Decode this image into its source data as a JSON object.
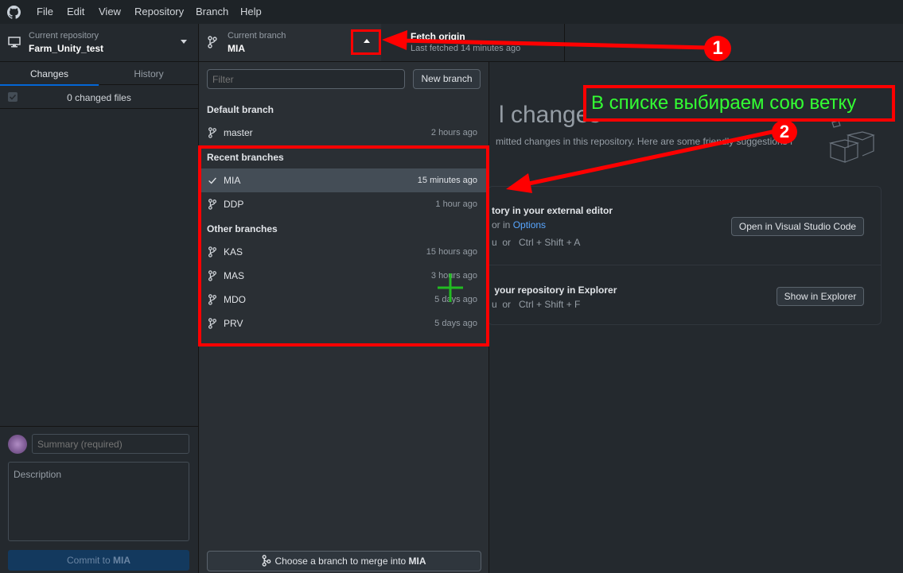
{
  "menu": [
    "File",
    "Edit",
    "View",
    "Repository",
    "Branch",
    "Help"
  ],
  "toolbar": {
    "repo_label": "Current repository",
    "repo_value": "Farm_Unity_test",
    "branch_label": "Current branch",
    "branch_value": "MIA",
    "fetch_title": "Fetch origin",
    "fetch_sub": "Last fetched 14 minutes ago"
  },
  "left": {
    "tabs": [
      "Changes",
      "History"
    ],
    "changed_files": "0 changed files",
    "summary_placeholder": "Summary (required)",
    "description_placeholder": "Description",
    "commit_prefix": "Commit to ",
    "commit_branch": "MIA"
  },
  "dropdown": {
    "filter_placeholder": "Filter",
    "new_branch": "New branch",
    "default_header": "Default branch",
    "default_branches": [
      {
        "name": "master",
        "time": "2 hours ago"
      }
    ],
    "recent_header": "Recent branches",
    "recent_branches": [
      {
        "name": "MIA",
        "time": "15 minutes ago",
        "current": true
      },
      {
        "name": "DDP",
        "time": "1 hour ago"
      }
    ],
    "other_header": "Other branches",
    "other_branches": [
      {
        "name": "KAS",
        "time": "15 hours ago"
      },
      {
        "name": "MAS",
        "time": "3 hours ago"
      },
      {
        "name": "MDO",
        "time": "5 days ago"
      },
      {
        "name": "PRV",
        "time": "5 days ago"
      }
    ],
    "merge_prefix": "Choose a branch to merge into ",
    "merge_branch": "MIA"
  },
  "main": {
    "heading_partial": "l changes",
    "sub_partial": "mitted changes in this repository. Here are some friendly suggestions f",
    "card1_title": "tory in your external editor",
    "card1_sub_a": "or in ",
    "card1_link": "Options",
    "card1_kbd": "u  or   Ctrl + Shift + A",
    "card1_button": "Open in Visual Studio Code",
    "card2_title": " your repository in Explorer",
    "card2_kbd": "u  or   Ctrl + Shift + F",
    "card2_button": "Show in Explorer"
  },
  "annotations": {
    "callout_text": "В списке выбираем сою ветку",
    "marker1": "1",
    "marker2": "2",
    "red": "#ff0000",
    "green": "#33ff33"
  }
}
